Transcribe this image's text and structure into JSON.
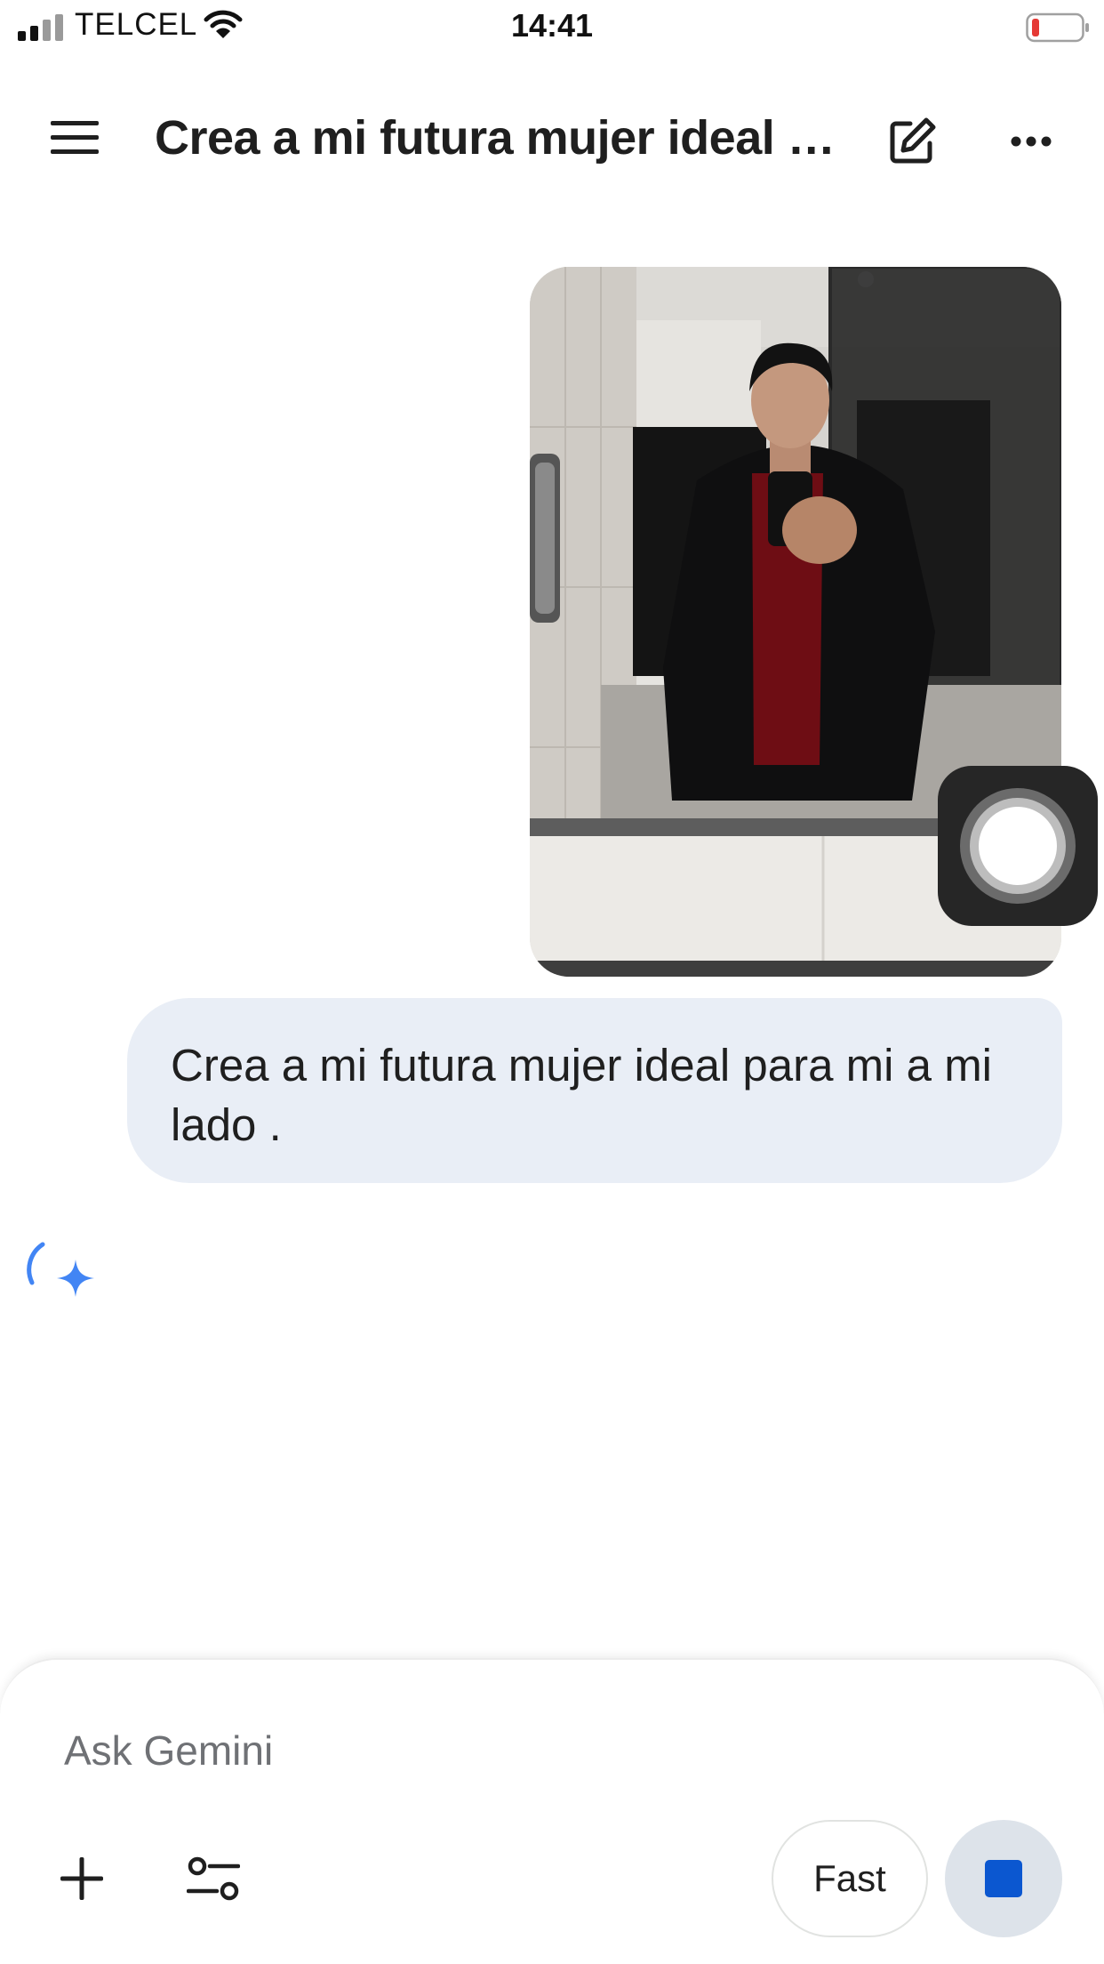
{
  "status_bar": {
    "carrier": "TELCEL",
    "time": "14:41",
    "signal_icon": "signal-bars-icon",
    "wifi_icon": "wifi-icon",
    "battery_icon": "battery-low-icon",
    "battery_color": "#e53935"
  },
  "app_bar": {
    "title": "Crea a mi futura mujer ideal para mi a mi lado .",
    "menu_icon": "hamburger-menu-icon",
    "edit_icon": "new-chat-edit-icon",
    "more_icon": "more-horizontal-icon"
  },
  "conversation": {
    "attachment": {
      "kind": "photo",
      "icon": "photo-attachment"
    },
    "user_message": "Crea a mi futura mujer ideal para mi a mi lado .",
    "response_state": {
      "icon": "gemini-spark-loading-icon"
    }
  },
  "overlay": {
    "assistive_touch_icon": "assistive-touch-icon"
  },
  "composer": {
    "placeholder": "Ask Gemini",
    "value": "",
    "add_icon": "plus-icon",
    "tools_icon": "tools-sliders-icon",
    "mode_chip_label": "Fast",
    "stop_icon": "stop-icon"
  },
  "colors": {
    "accent": "#0b57d0",
    "user_bubble": "#e9eef6",
    "stop_button_bg": "#dde3ea",
    "spark_blue": "#4285f4"
  }
}
